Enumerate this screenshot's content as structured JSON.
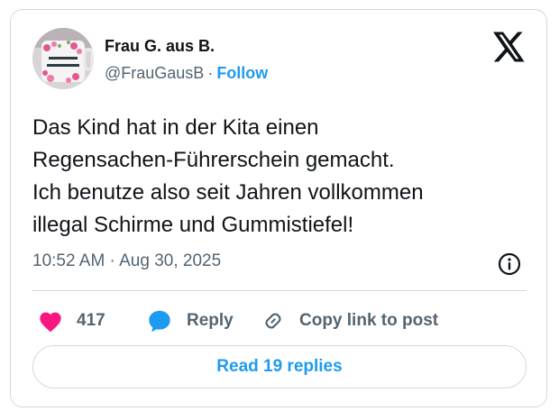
{
  "author": {
    "display_name": "Frau G. aus B.",
    "handle": "@FrauGausB",
    "separator": "·",
    "follow_label": "Follow",
    "avatar_icon": "mug-photo-avatar"
  },
  "tweet": {
    "lines": [
      "Das Kind hat in der Kita einen",
      "Regensachen-Führerschein gemacht.",
      "Ich benutze also seit Jahren vollkommen",
      "illegal Schirme und Gummistiefel!"
    ],
    "timestamp": "10:52 AM · Aug 30, 2025"
  },
  "actions": {
    "like_count": "417",
    "reply_label": "Reply",
    "copy_link_label": "Copy link to post",
    "read_replies_label": "Read 19 replies"
  },
  "icons": {
    "logo": "x-logo-icon",
    "info": "info-icon",
    "like": "heart-icon",
    "reply": "speech-bubble-icon",
    "copy": "link-icon"
  },
  "colors": {
    "accent": "#1d9bf0",
    "like": "#f91880",
    "text": "#0f1419",
    "secondary": "#536471",
    "border": "#cfd9de"
  }
}
